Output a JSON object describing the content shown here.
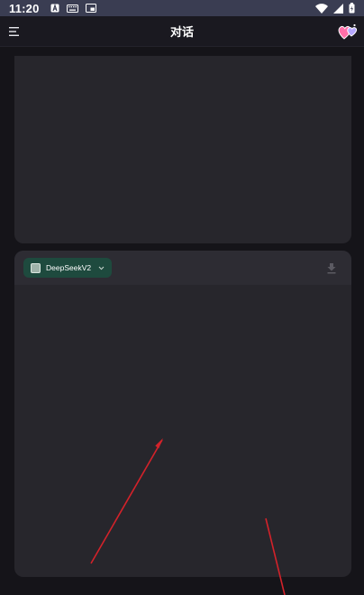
{
  "status_bar": {
    "time": "11:20",
    "left_icons": [
      "a-icon",
      "keyboard-icon",
      "picture-in-picture-icon"
    ],
    "right_icons": [
      "wifi-icon",
      "signal-icon",
      "battery-icon"
    ]
  },
  "app_bar": {
    "title": "对话",
    "menu_icon": "menu-icon",
    "action_icon": "hearts-icon"
  },
  "conversation_card": {
    "model_chip": {
      "label": "DeepSeekV2",
      "icon": "model-square-icon",
      "dropdown_icon": "chevron-down-icon"
    },
    "download_icon": "download-icon"
  },
  "colors": {
    "background": "#151419",
    "status_bar": "#3a3d52",
    "card": "#27262c",
    "chip": "#1e4a3e",
    "annotation_arrow": "#d3222a"
  }
}
